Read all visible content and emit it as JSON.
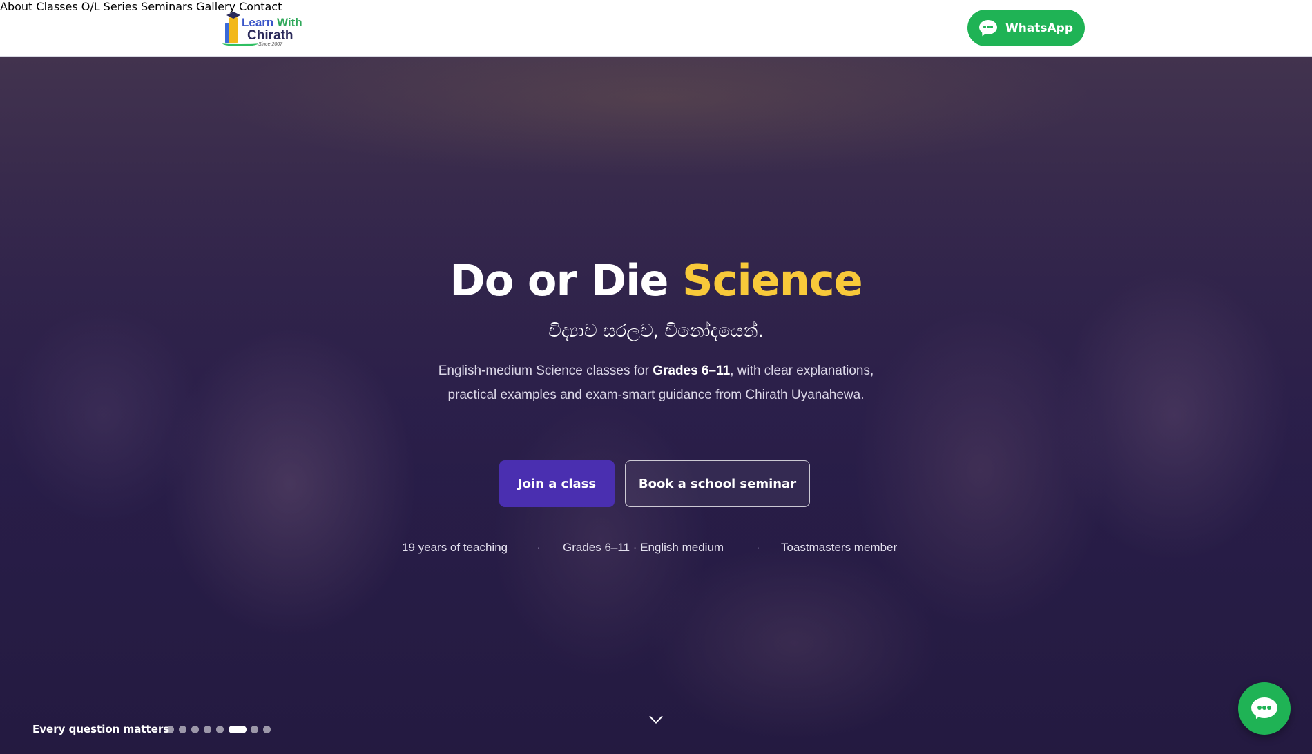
{
  "brand": {
    "logo_line1_a": "Learn ",
    "logo_line1_b": "With",
    "logo_line2": "Chirath",
    "logo_line3": "Since 2007"
  },
  "nav": {
    "items": [
      {
        "label": "About"
      },
      {
        "label": "Classes"
      },
      {
        "label": "O/L Series"
      },
      {
        "label": "Seminars"
      },
      {
        "label": "Gallery"
      },
      {
        "label": "Contact"
      }
    ],
    "whatsapp_label": "WhatsApp",
    "whatsapp_icon": "whatsapp-chat-icon"
  },
  "hero": {
    "title_part1": "Do or Die ",
    "title_part2": "Science",
    "subtitle": "විද්‍යාව සරලව, විනෝදයෙන්.",
    "desc_before": "English-medium Science classes for ",
    "desc_bold": "Grades 6–11",
    "desc_after": ", with clear explanations, practical examples and exam-smart guidance from Chirath Uyanahewa.",
    "primary_button": "Join a class",
    "secondary_button": "Book a school seminar",
    "stats": [
      "19 years of teaching",
      "Grades 6–11 · English medium",
      "Toastmasters member"
    ],
    "stat_separator": "·",
    "slide_caption": "Every question matters",
    "slide_count": 8,
    "active_slide": 6
  },
  "colors": {
    "accent_yellow": "#f8c93a",
    "primary_purple": "#4a2fb0",
    "whatsapp_green": "#1fb355"
  }
}
